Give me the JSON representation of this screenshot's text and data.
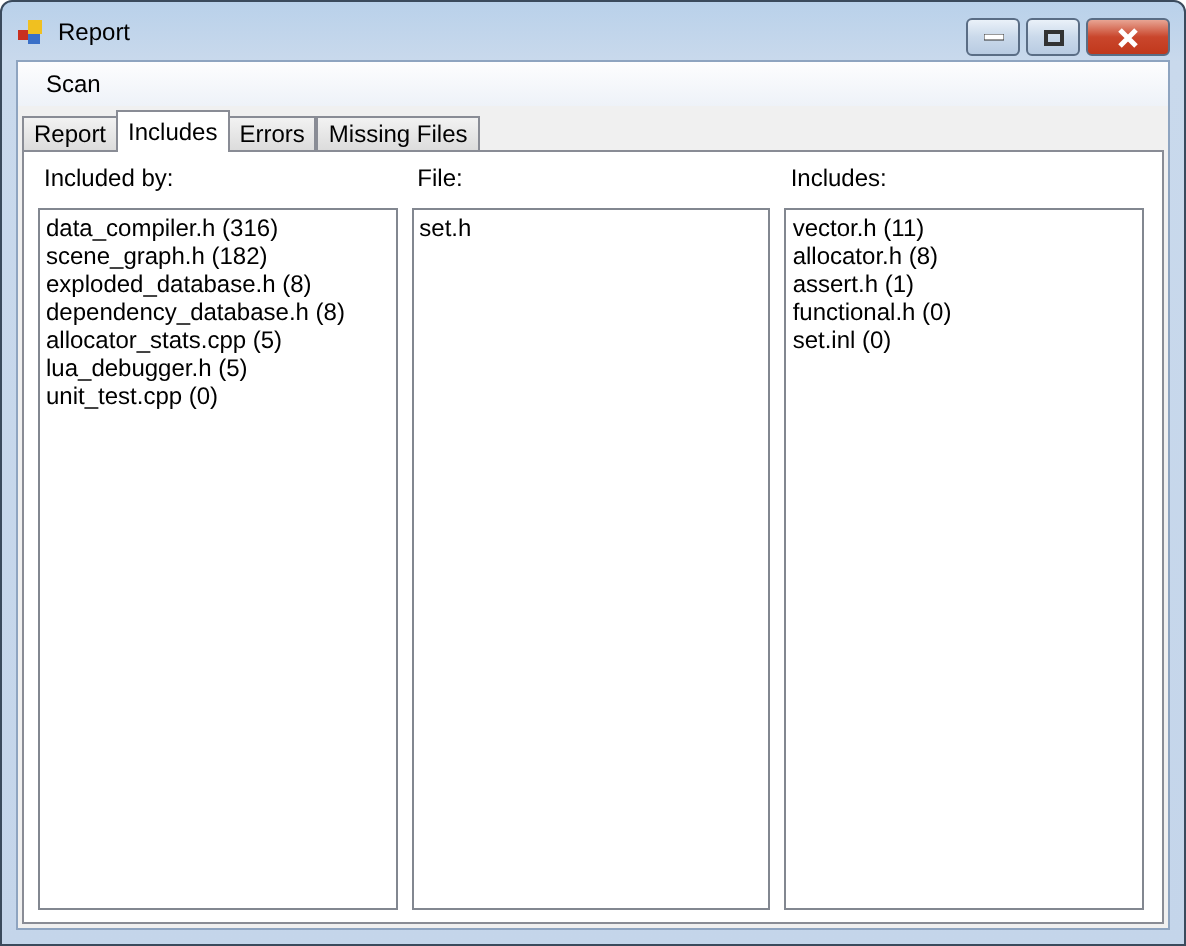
{
  "window": {
    "title": "Report"
  },
  "menu": [
    "Scan"
  ],
  "tabs": [
    {
      "label": "Report",
      "selected": false
    },
    {
      "label": "Includes",
      "selected": true
    },
    {
      "label": "Errors",
      "selected": false
    },
    {
      "label": "Missing Files",
      "selected": false
    }
  ],
  "columns": [
    {
      "label": "Included by:",
      "items": [
        "data_compiler.h (316)",
        "scene_graph.h (182)",
        "exploded_database.h (8)",
        "dependency_database.h (8)",
        "allocator_stats.cpp (5)",
        "lua_debugger.h (5)",
        "unit_test.cpp (0)"
      ]
    },
    {
      "label": "File:",
      "items": [
        "set.h"
      ]
    },
    {
      "label": "Includes:",
      "items": [
        "vector.h (11)",
        "allocator.h (8)",
        "assert.h (1)",
        "functional.h (0)",
        "set.inl (0)"
      ]
    }
  ]
}
